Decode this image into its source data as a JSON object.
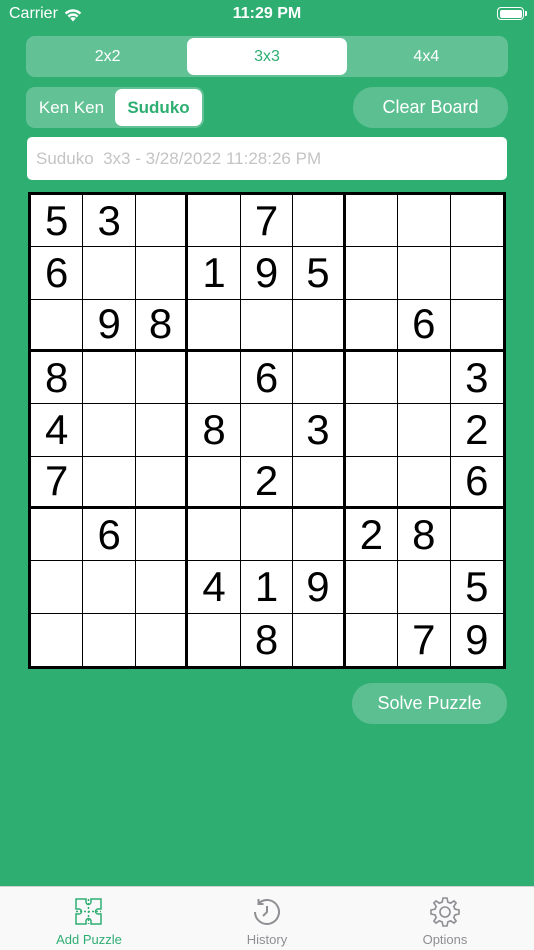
{
  "status": {
    "carrier": "Carrier",
    "time": "11:29 PM"
  },
  "size_segment": {
    "items": [
      "2x2",
      "3x3",
      "4x4"
    ],
    "selected": "3x3"
  },
  "mode_segment": {
    "items": [
      "Ken Ken",
      "Suduko"
    ],
    "selected": "Suduko"
  },
  "clear_label": "Clear Board",
  "solve_label": "Solve Puzzle",
  "title_field": {
    "value": "",
    "placeholder": "Suduko  3x3 - 3/28/2022 11:28:26 PM"
  },
  "board": [
    [
      "5",
      "3",
      "",
      "",
      "7",
      "",
      "",
      "",
      ""
    ],
    [
      "6",
      "",
      "",
      "1",
      "9",
      "5",
      "",
      "",
      ""
    ],
    [
      "",
      "9",
      "8",
      "",
      "",
      "",
      "",
      "6",
      ""
    ],
    [
      "8",
      "",
      "",
      "",
      "6",
      "",
      "",
      "",
      "3"
    ],
    [
      "4",
      "",
      "",
      "8",
      "",
      "3",
      "",
      "",
      "2"
    ],
    [
      "7",
      "",
      "",
      "",
      "2",
      "",
      "",
      "",
      "6"
    ],
    [
      "",
      "6",
      "",
      "",
      "",
      "",
      "2",
      "8",
      ""
    ],
    [
      "",
      "",
      "",
      "4",
      "1",
      "9",
      "",
      "",
      "5"
    ],
    [
      "",
      "",
      "",
      "",
      "8",
      "",
      "",
      "7",
      "9"
    ]
  ],
  "tabs": [
    {
      "label": "Add Puzzle",
      "icon": "puzzle-icon",
      "active": true
    },
    {
      "label": "History",
      "icon": "history-icon",
      "active": false
    },
    {
      "label": "Options",
      "icon": "gear-icon",
      "active": false
    }
  ],
  "colors": {
    "accent": "#2fae72",
    "tab_inactive": "#8e8e93"
  }
}
